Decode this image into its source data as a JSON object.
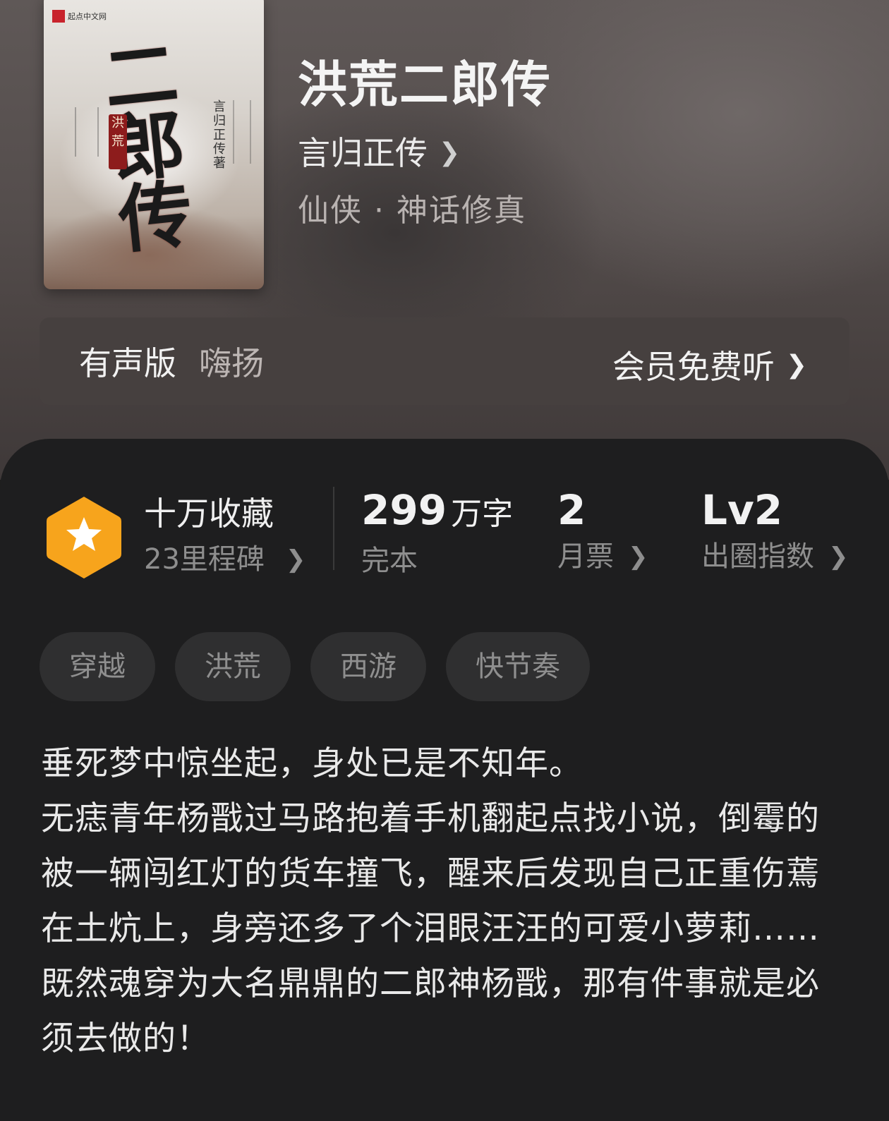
{
  "book": {
    "title": "洪荒二郎传",
    "author": "言归正传",
    "genre": "仙侠 · 神话修真",
    "cover": {
      "publisher": "起点中文网",
      "big_title": "二郎传",
      "seal": "洪荒",
      "vertical_author": "言归正传著"
    }
  },
  "audio": {
    "label": "有声版",
    "narrator": "嗨扬",
    "cta": "会员免费听"
  },
  "stats": {
    "collect_title": "十万收藏",
    "collect_sub": "23里程碑",
    "words_value": "299",
    "words_unit": "万字",
    "words_label": "完本",
    "tickets_value": "2",
    "tickets_label": "月票",
    "index_value": "Lv2",
    "index_label": "出圈指数"
  },
  "tags": [
    "穿越",
    "洪荒",
    "西游",
    "快节奏"
  ],
  "description": [
    "垂死梦中惊坐起，身处已是不知年。",
    "无痣青年杨戬过马路抱着手机翻起点找小说，倒霉的被一辆闯红灯的货车撞飞，醒来后发现自己正重伤蔫在土炕上，身旁还多了个泪眼汪汪的可爱小萝莉……",
    "既然魂穿为大名鼎鼎的二郎神杨戬，那有件事就是必须去做的！"
  ],
  "colors": {
    "badge_orange": "#f7a41c",
    "panel_bg": "#1e1e1f"
  },
  "icons": {
    "chevron": "chevron-right-icon",
    "badge": "star-hexagon-icon"
  }
}
